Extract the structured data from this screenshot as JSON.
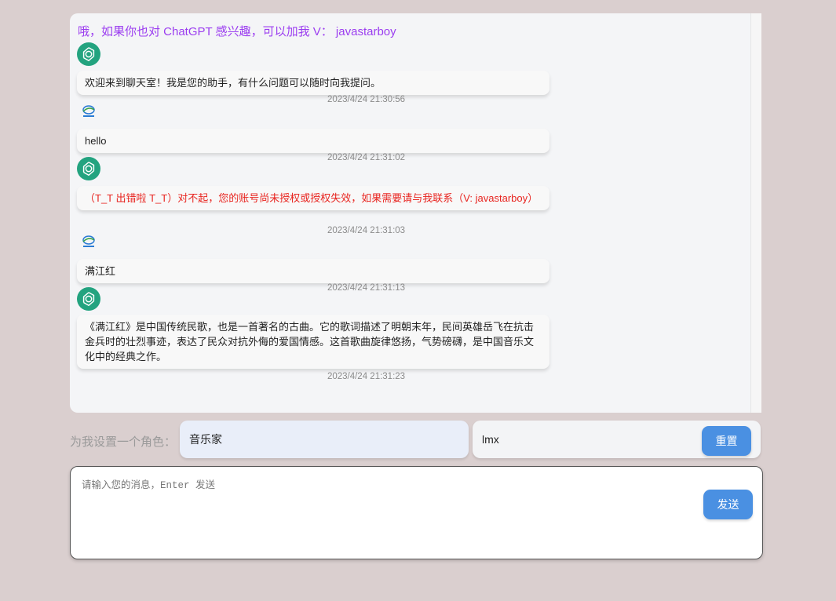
{
  "notice": "哦，如果你也对 ChatGPT 感兴趣，可以加我 V： javastarboy",
  "messages": [
    {
      "role": "assistant",
      "text": "欢迎来到聊天室！我是您的助手，有什么问题可以随时向我提问。",
      "time": "2023/4/24 21:30:56"
    },
    {
      "role": "user",
      "text": "hello",
      "time": "2023/4/24 21:31:02"
    },
    {
      "role": "assistant",
      "text": "（T_T 出错啦 T_T）对不起，您的账号尚未授权或授权失效，如果需要请与我联系（V: javastarboy）",
      "time": "2023/4/24 21:31:03",
      "error": true
    },
    {
      "role": "user",
      "text": "满江红",
      "time": "2023/4/24 21:31:13"
    },
    {
      "role": "assistant",
      "text": "《满江红》是中国传统民歌，也是一首著名的古曲。它的歌词描述了明朝末年，民间英雄岳飞在抗击金兵时的壮烈事迹，表达了民众对抗外侮的爱国情感。这首歌曲旋律悠扬，气势磅礴，是中国音乐文化中的经典之作。",
      "time": "2023/4/24 21:31:23"
    }
  ],
  "role_setting": {
    "label": "为我设置一个角色：",
    "value": "音乐家"
  },
  "name_field": {
    "value": "lmx",
    "reset_label": "重置"
  },
  "composer": {
    "placeholder": "请输入您的消息，Enter 发送",
    "send_label": "发送"
  },
  "colors": {
    "accent": "#4a90e2",
    "notice": "#9b3df0",
    "error": "#e8241f",
    "gpt_avatar": "#23a37f",
    "background": "#dacfcf"
  },
  "icons": {
    "assistant_avatar": "openai-logo-icon",
    "user_avatar": "user-avatar-icon"
  }
}
